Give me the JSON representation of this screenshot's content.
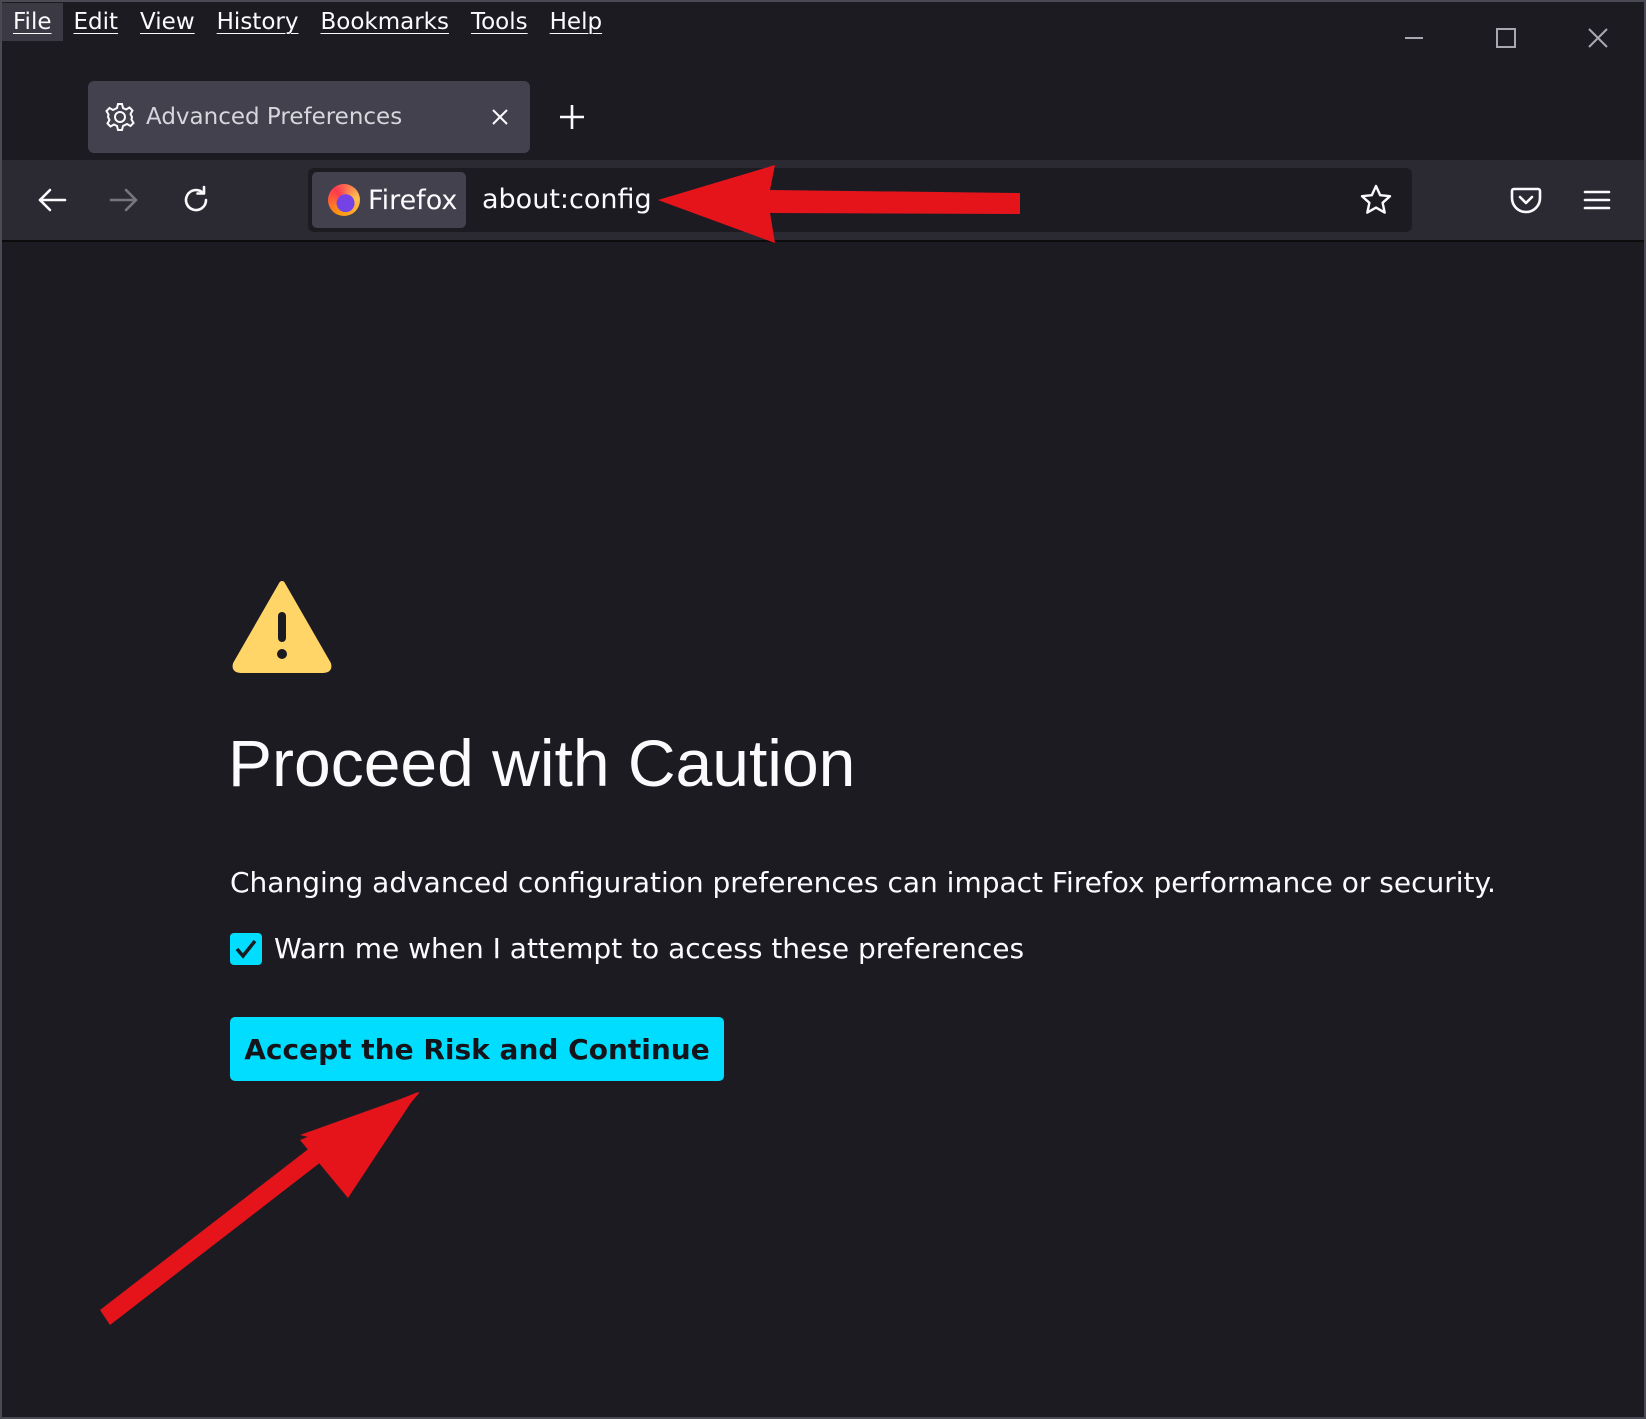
{
  "menubar": {
    "items": [
      {
        "label": "File"
      },
      {
        "label": "Edit"
      },
      {
        "label": "View"
      },
      {
        "label": "History"
      },
      {
        "label": "Bookmarks"
      },
      {
        "label": "Tools"
      },
      {
        "label": "Help"
      }
    ]
  },
  "tab": {
    "title": "Advanced Preferences",
    "icon": "gear-icon"
  },
  "urlbar": {
    "identity_label": "Firefox",
    "url": "about:config"
  },
  "page": {
    "title": "Proceed with Caution",
    "description": "Changing advanced configuration preferences can impact Firefox performance or security.",
    "checkbox_label": "Warn me when I attempt to access these preferences",
    "checkbox_checked": true,
    "accept_button": "Accept the Risk and Continue"
  },
  "colors": {
    "background": "#1c1b22",
    "toolbar": "#2b2a33",
    "accent": "#00ddff",
    "warning": "#ffd567",
    "annotation_arrow": "#e5141b"
  }
}
